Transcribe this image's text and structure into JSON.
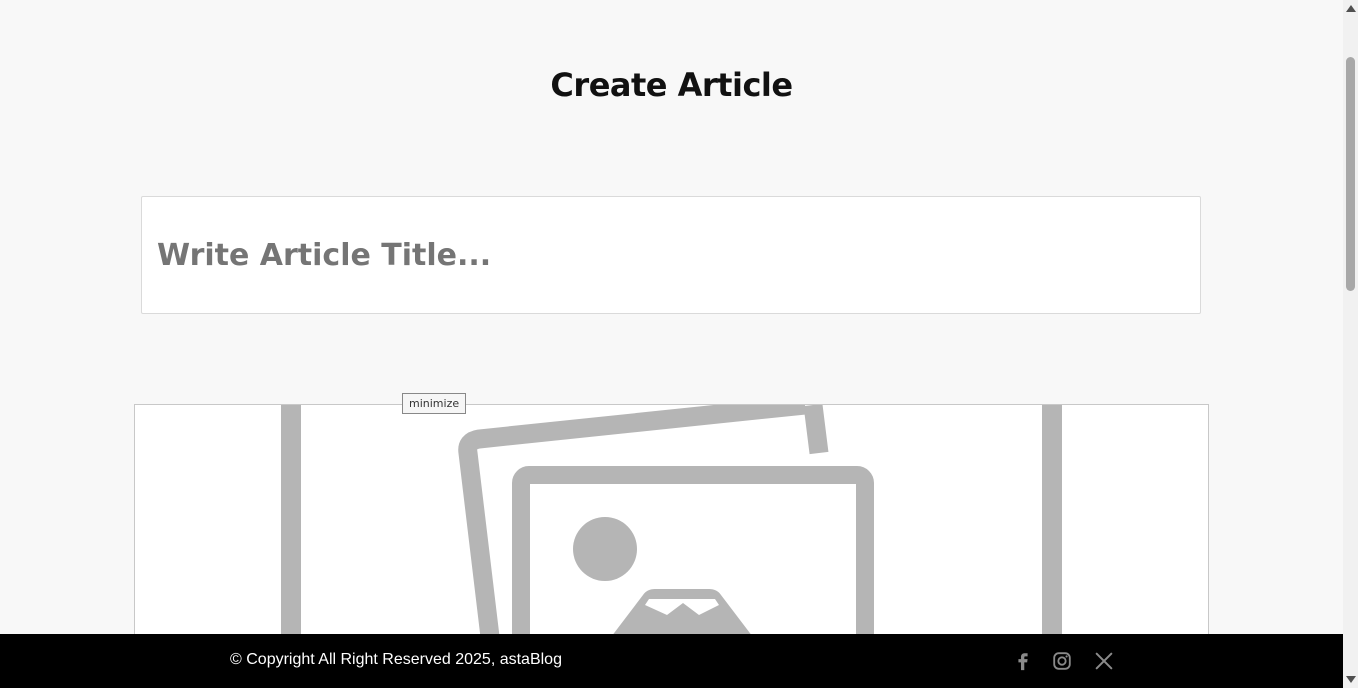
{
  "page": {
    "title": "Create Article"
  },
  "title_input": {
    "placeholder": "Write Article Title...",
    "value": ""
  },
  "image_upload": {
    "icon": "image-placeholder-icon",
    "tooltip": "minimize"
  },
  "footer": {
    "copyright": "© Copyright All Right Reserved 2025, astaBlog",
    "social": [
      {
        "icon": "facebook-icon"
      },
      {
        "icon": "instagram-icon"
      },
      {
        "icon": "x-twitter-icon"
      }
    ]
  },
  "colors": {
    "background": "#f8f8f8",
    "footer_bg": "#000000",
    "social_icon": "#8a8a8a",
    "placeholder_graphic": "#b5b5b5"
  }
}
